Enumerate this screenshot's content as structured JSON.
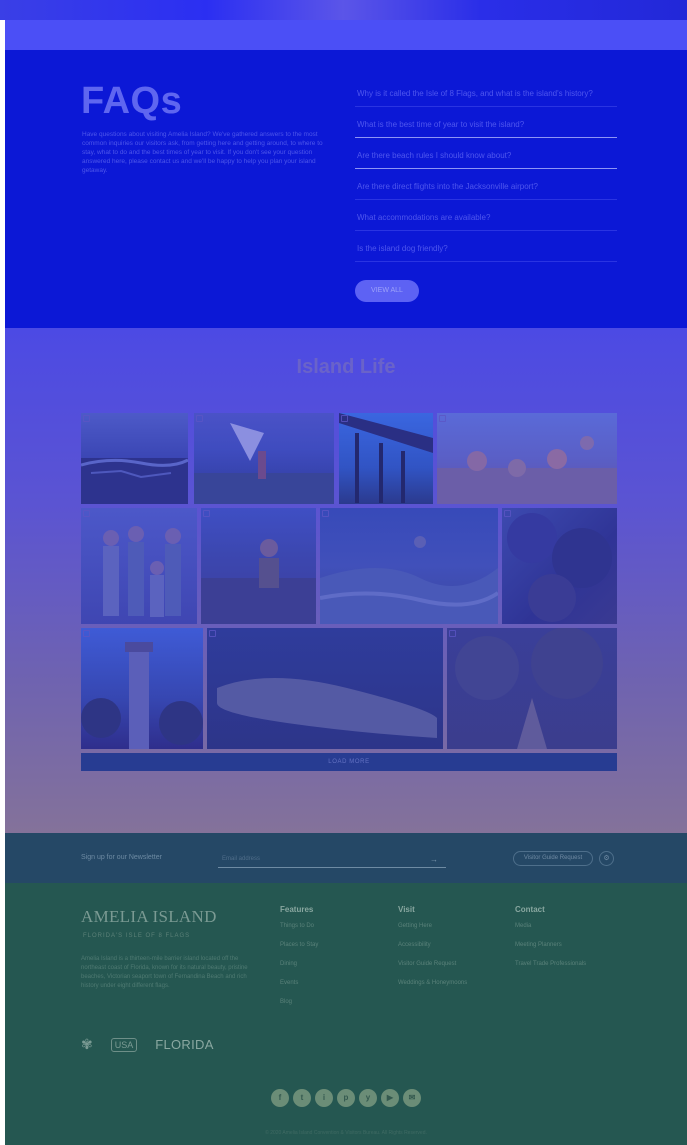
{
  "faq": {
    "title": "FAQs",
    "intro": "Have questions about visiting Amelia Island? We've gathered answers to the most common inquiries our visitors ask, from getting here and getting around, to where to stay, what to do and the best times of year to visit. If you don't see your question answered here, please contact us and we'll be happy to help you plan your island getaway.",
    "questions": [
      "Why is it called the Isle of 8 Flags, and what is the island's history?",
      "What is the best time of year to visit the island?",
      "Are there beach rules I should know about?",
      "Are there direct flights into the Jacksonville airport?",
      "What accommodations are available?",
      "Is the island dog friendly?"
    ],
    "button_label": "VIEW ALL"
  },
  "island": {
    "title": "Island Life",
    "load_more_label": "LOAD MORE"
  },
  "newsletter": {
    "label": "Sign up for our Newsletter",
    "placeholder": "Email address",
    "submit_icon": "arrow-right-icon",
    "submit_glyph": "→",
    "button_label": "Visitor Guide Request",
    "gear_glyph": "⚙"
  },
  "footer": {
    "logo": "AMELIA ISLAND",
    "tagline": "FLORIDA'S ISLE OF 8 FLAGS",
    "about": "Amelia Island is a thirteen-mile barrier island located off the northeast coast of Florida, known for its natural beauty, pristine beaches, Victorian seaport town of Fernandina Beach and rich history under eight different flags.",
    "badge_1": "✾",
    "badge_2": "USA",
    "florida_label": "FLORIDA",
    "columns": [
      {
        "title": "Features",
        "items": [
          "Things to Do",
          "Places to Stay",
          "Dining",
          "Events",
          "Blog"
        ]
      },
      {
        "title": "Visit",
        "items": [
          "Getting Here",
          "Accessibility",
          "Visitor Guide Request",
          "Weddings & Honeymoons"
        ]
      },
      {
        "title": "Contact",
        "items": [
          "Media",
          "Meeting Planners",
          "Travel Trade Professionals"
        ]
      }
    ],
    "social": [
      "f",
      "t",
      "i",
      "p",
      "y",
      "▶",
      "✉"
    ],
    "copyright": "© 2020 Amelia Island Convention & Visitors Bureau. All Rights Reserved."
  },
  "colors": {
    "faq_bg": "#0c18d6",
    "footer_bg": "#255751",
    "newsletter_bg": "#254866"
  }
}
